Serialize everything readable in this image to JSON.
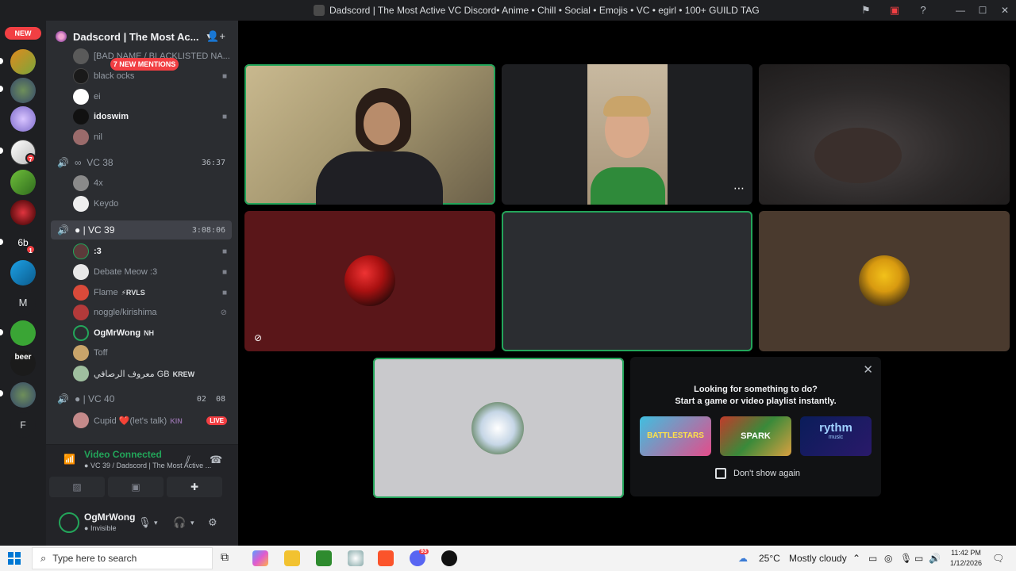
{
  "window": {
    "title": "Dadscord | The Most Active VC Discord• Anime • Chill • Social • Emojis • VC • egirl • 100+ GUILD TAG"
  },
  "guilds": {
    "new_label": "NEW",
    "badges": [
      "7",
      "1"
    ],
    "letters": [
      "6b",
      "M",
      "F"
    ],
    "beer_label": "beer"
  },
  "server": {
    "name": "Dadscord | The Most Ac...",
    "mentions_label": "7 NEW MENTIONS"
  },
  "members_top": [
    {
      "name": "[BAD NAME / BLACKLISTED NA...",
      "color": "#5a5a5a"
    },
    {
      "name": "black ocks",
      "color": "#1a1a1a"
    },
    {
      "name": "ei",
      "color": "#ffffff"
    },
    {
      "name": "idoswim",
      "color": "#111111",
      "bold": true
    },
    {
      "name": "nil",
      "color": "#9b6b6b"
    }
  ],
  "vc38": {
    "name": "VC 38",
    "prefix": "∞",
    "timer": "36:37"
  },
  "vc38_members": [
    {
      "name": "4x",
      "color": "#8a8a8a"
    },
    {
      "name": "Keydo",
      "color": "#eeeeee"
    }
  ],
  "vc39": {
    "name": "VC 39",
    "timer": "3:08:06"
  },
  "vc39_members": [
    {
      "name": ":3",
      "color": "#5c3a3a"
    },
    {
      "name": "Debate Meow :3",
      "color": "#e8e8e8"
    },
    {
      "name": "Flame",
      "tag": "⚡RVLS",
      "color": "#d94a3a"
    },
    {
      "name": "noggle/kirishima",
      "color": "#b33a3a"
    },
    {
      "name": "OgMrWong",
      "tag": "NH",
      "color": "#2b2d31"
    },
    {
      "name": "Toff",
      "color": "#c9a46a"
    },
    {
      "name": "معروف الرصافي GB",
      "tag": "KREW",
      "color": "#9fbf9f"
    }
  ],
  "vc40": {
    "name": "VC 40",
    "timer_a": "02",
    "timer_b": "08"
  },
  "vc40_members": [
    {
      "name": "Cupid ❤️(let's talk)",
      "tag": "KIN",
      "live": "LIVE",
      "color": "#c48a8a"
    }
  ],
  "voice": {
    "status": "Video Connected",
    "channel": "VC 39 / Dadscord | The Most Active ..."
  },
  "user": {
    "name": "OgMrWong",
    "status": "Invisible"
  },
  "suggestion": {
    "line1": "Looking for something to do?",
    "line2": "Start a game or video playlist instantly.",
    "activities": [
      "BATTLESTARS",
      "SPARK",
      "rythm"
    ],
    "activity_sub": "music",
    "dont_show": "Don't show again"
  },
  "taskbar": {
    "search_placeholder": "Type here to search",
    "weather_temp": "25°C",
    "weather_desc": "Mostly cloudy",
    "time": "11:42 PM",
    "date": "1/12/2026",
    "discord_badge": "93"
  },
  "colors": {
    "accent_green": "#23a55a",
    "danger_red": "#f23f43",
    "sidebar_bg": "#2b2d31",
    "guild_bg": "#1e1f22"
  }
}
